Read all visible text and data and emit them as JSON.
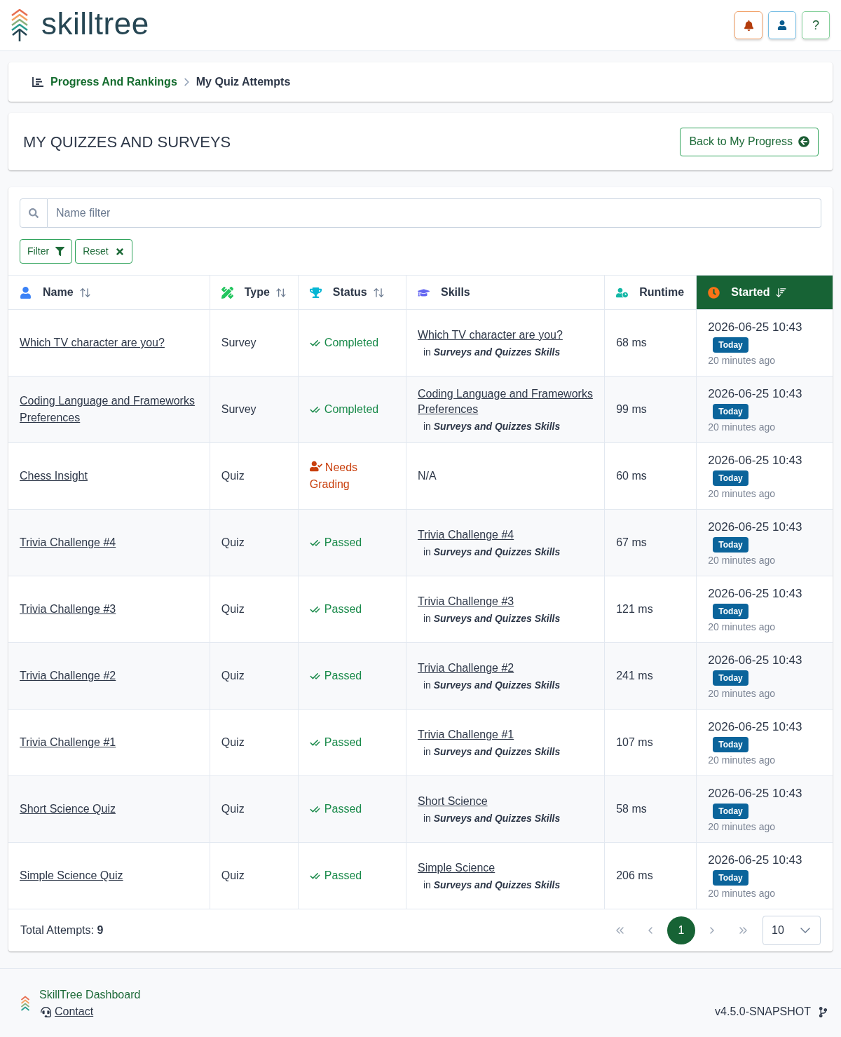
{
  "header": {
    "logo_text": "skilltree",
    "help_button": "?"
  },
  "breadcrumb": [
    {
      "label": "Progress And Rankings",
      "kind": "link"
    },
    {
      "label": "My Quiz Attempts",
      "kind": "current"
    }
  ],
  "page_title": "MY QUIZZES AND SURVEYS",
  "back_button": "Back to My Progress",
  "search": {
    "placeholder": "Name filter"
  },
  "filter_buttons": [
    {
      "label": "Filter",
      "kind": "filter"
    },
    {
      "label": "Reset",
      "kind": "reset"
    }
  ],
  "table": {
    "columns": [
      {
        "label": "Name",
        "sortable": true,
        "selected": false
      },
      {
        "label": "Type",
        "sortable": true,
        "selected": false
      },
      {
        "label": "Status",
        "sortable": true,
        "selected": false
      },
      {
        "label": "Skills",
        "sortable": false,
        "selected": false
      },
      {
        "label": "Runtime",
        "sortable": false,
        "selected": false
      },
      {
        "label": "Started",
        "sortable": true,
        "selected": true
      }
    ],
    "rows": [
      {
        "name": "Which TV character are you?",
        "type": "Survey",
        "status": {
          "label": "Completed",
          "kind": "done"
        },
        "skill": {
          "kind": "link",
          "name": "Which TV character are you?",
          "prefix": "in",
          "project": "Surveys and Quizzes Skills"
        },
        "runtime": "68 ms",
        "started": {
          "date": "2026-06-25 10:43",
          "badge": "Today",
          "relative": "20 minutes ago"
        }
      },
      {
        "name": "Coding Language and Frameworks Preferences",
        "type": "Survey",
        "status": {
          "label": "Completed",
          "kind": "done"
        },
        "skill": {
          "kind": "link",
          "name": "Coding Language and Frameworks Preferences",
          "prefix": "in",
          "project": "Surveys and Quizzes Skills"
        },
        "runtime": "99 ms",
        "started": {
          "date": "2026-06-25 10:43",
          "badge": "Today",
          "relative": "20 minutes ago"
        }
      },
      {
        "name": "Chess Insight",
        "type": "Quiz",
        "status": {
          "label": "Needs Grading",
          "kind": "grading"
        },
        "skill": {
          "kind": "none",
          "name": "N/A"
        },
        "runtime": "60 ms",
        "started": {
          "date": "2026-06-25 10:43",
          "badge": "Today",
          "relative": "20 minutes ago"
        }
      },
      {
        "name": "Trivia Challenge #4",
        "type": "Quiz",
        "status": {
          "label": "Passed",
          "kind": "done"
        },
        "skill": {
          "kind": "link",
          "name": "Trivia Challenge #4",
          "prefix": "in",
          "project": "Surveys and Quizzes Skills"
        },
        "runtime": "67 ms",
        "started": {
          "date": "2026-06-25 10:43",
          "badge": "Today",
          "relative": "20 minutes ago"
        }
      },
      {
        "name": "Trivia Challenge #3",
        "type": "Quiz",
        "status": {
          "label": "Passed",
          "kind": "done"
        },
        "skill": {
          "kind": "link",
          "name": "Trivia Challenge #3",
          "prefix": "in",
          "project": "Surveys and Quizzes Skills"
        },
        "runtime": "121 ms",
        "started": {
          "date": "2026-06-25 10:43",
          "badge": "Today",
          "relative": "20 minutes ago"
        }
      },
      {
        "name": "Trivia Challenge #2",
        "type": "Quiz",
        "status": {
          "label": "Passed",
          "kind": "done"
        },
        "skill": {
          "kind": "link",
          "name": "Trivia Challenge #2",
          "prefix": "in",
          "project": "Surveys and Quizzes Skills"
        },
        "runtime": "241 ms",
        "started": {
          "date": "2026-06-25 10:43",
          "badge": "Today",
          "relative": "20 minutes ago"
        }
      },
      {
        "name": "Trivia Challenge #1",
        "type": "Quiz",
        "status": {
          "label": "Passed",
          "kind": "done"
        },
        "skill": {
          "kind": "link",
          "name": "Trivia Challenge #1",
          "prefix": "in",
          "project": "Surveys and Quizzes Skills"
        },
        "runtime": "107 ms",
        "started": {
          "date": "2026-06-25 10:43",
          "badge": "Today",
          "relative": "20 minutes ago"
        }
      },
      {
        "name": "Short Science Quiz",
        "type": "Quiz",
        "status": {
          "label": "Passed",
          "kind": "done"
        },
        "skill": {
          "kind": "link",
          "name": "Short Science",
          "prefix": "in",
          "project": "Surveys and Quizzes Skills"
        },
        "runtime": "58 ms",
        "started": {
          "date": "2026-06-25 10:43",
          "badge": "Today",
          "relative": "20 minutes ago"
        }
      },
      {
        "name": "Simple Science Quiz",
        "type": "Quiz",
        "status": {
          "label": "Passed",
          "kind": "done"
        },
        "skill": {
          "kind": "link",
          "name": "Simple Science",
          "prefix": "in",
          "project": "Surveys and Quizzes Skills"
        },
        "runtime": "206 ms",
        "started": {
          "date": "2026-06-25 10:43",
          "badge": "Today",
          "relative": "20 minutes ago"
        }
      }
    ]
  },
  "total": "Total Attempts: **9**",
  "pagination": {
    "pages": [
      {
        "label": "1",
        "selected": true
      }
    ],
    "page_size": "10"
  },
  "footer": {
    "title": "SkillTree Dashboard",
    "contact": "Contact",
    "version": "v4.5.0-SNAPSHOT"
  }
}
